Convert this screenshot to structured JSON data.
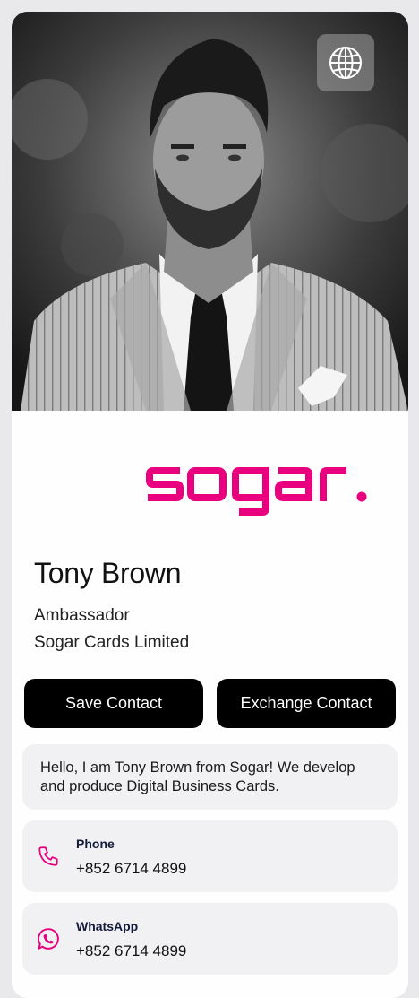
{
  "profile": {
    "name": "Tony Brown",
    "role": "Ambassador",
    "company": "Sogar Cards Limited",
    "photo_icon": "profile-photo"
  },
  "brand": {
    "logo_text": "sogar.",
    "accent_color": "#e8007f"
  },
  "header": {
    "globe_icon": "globe-icon"
  },
  "actions": {
    "save_label": "Save Contact",
    "exchange_label": "Exchange Contact"
  },
  "bio": {
    "text": "Hello, I am Tony Brown from Sogar! We develop and produce Digital Business Cards."
  },
  "contacts": [
    {
      "label": "Phone",
      "value": "+852 6714 4899",
      "icon": "phone-icon"
    },
    {
      "label": "WhatsApp",
      "value": "+852 6714 4899",
      "icon": "whatsapp-icon"
    }
  ]
}
